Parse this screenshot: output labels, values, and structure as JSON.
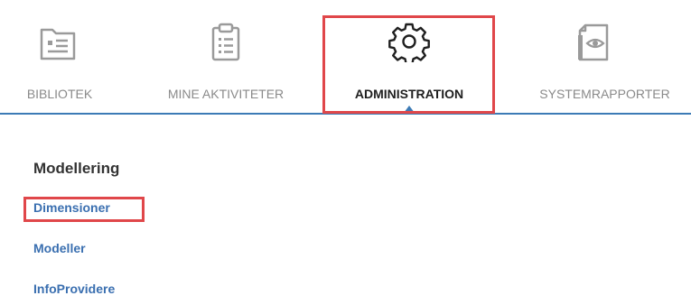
{
  "nav": {
    "items": [
      {
        "label": "BIBLIOTEK",
        "icon": "library-folder-icon"
      },
      {
        "label": "MINE AKTIVITETER",
        "icon": "clipboard-list-icon"
      },
      {
        "label": "ADMINISTRATION",
        "icon": "gear-icon",
        "active": true
      },
      {
        "label": "SYSTEMRAPPORTER",
        "icon": "document-eye-icon"
      }
    ],
    "accent_color": "#3d7bb6",
    "highlight_color": "#e0474a"
  },
  "content": {
    "section_title": "Modellering",
    "links": [
      {
        "label": "Dimensioner",
        "highlighted": true
      },
      {
        "label": "Modeller"
      },
      {
        "label": "InfoProvidere"
      }
    ]
  }
}
